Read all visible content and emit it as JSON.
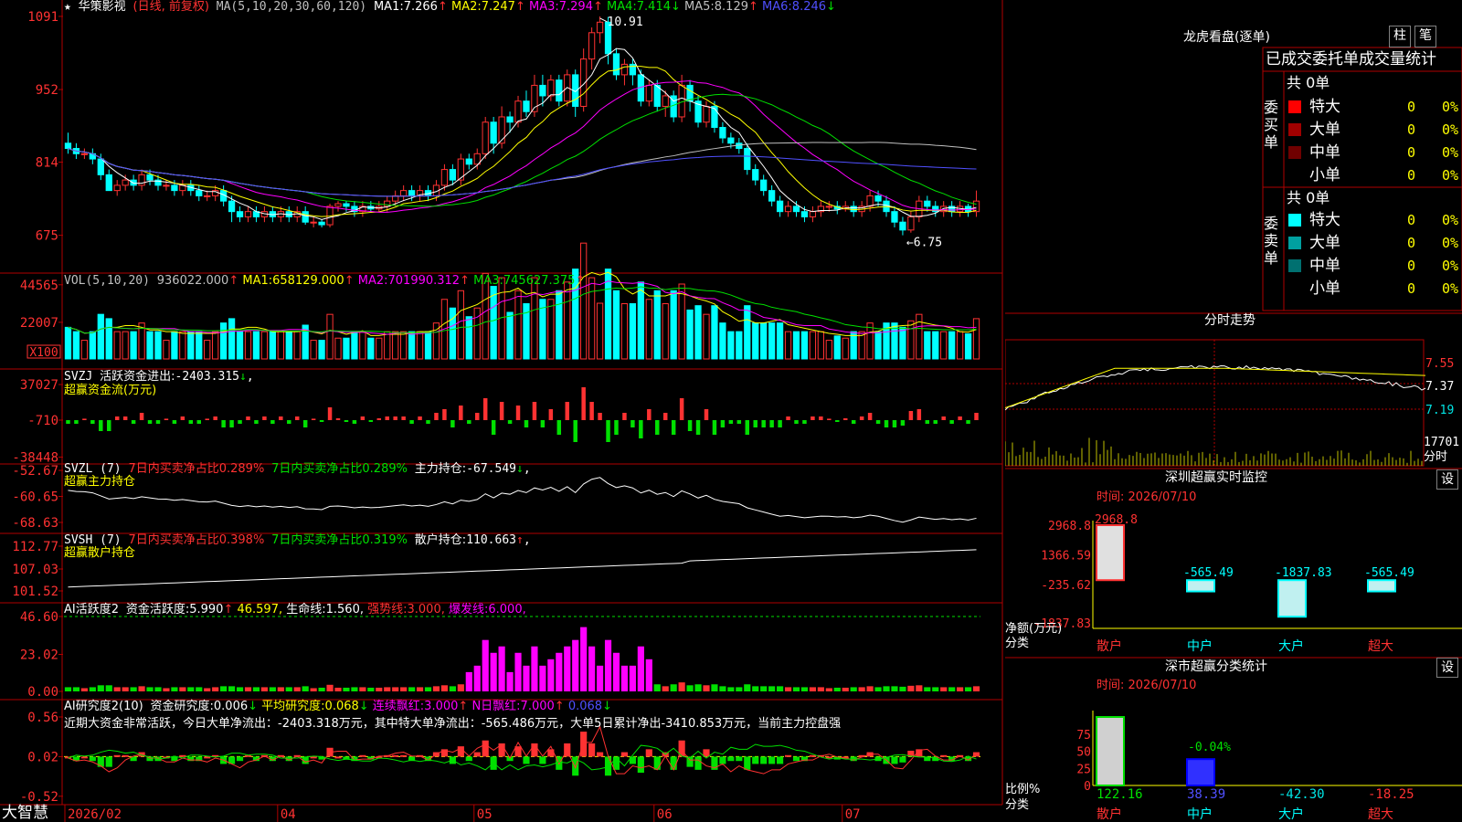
{
  "app": {
    "brand": "大智慧",
    "stock_name": "华策影视",
    "stock_mode": "(日线, 前复权)",
    "star": "★"
  },
  "colors": {
    "up": "#ff3232",
    "down": "#00ffff",
    "ma1": "#ffffff",
    "ma2": "#ffff00",
    "ma3": "#ff00ff",
    "ma4": "#00e000",
    "ma5": "#c0c0c0",
    "ma6": "#5050ff",
    "grid": "#b00000"
  },
  "price_panel": {
    "ma_label": "MA(5,10,20,30,60,120)",
    "ma_values": [
      {
        "label": "MA1:",
        "value": "7.266",
        "arrow": "↑",
        "color": "#ffffff"
      },
      {
        "label": "MA2:",
        "value": "7.247",
        "arrow": "↑",
        "color": "#ffff00"
      },
      {
        "label": "MA3:",
        "value": "7.294",
        "arrow": "↑",
        "color": "#ff00ff"
      },
      {
        "label": "MA4:",
        "value": "7.414",
        "arrow": "↓",
        "color": "#00e000"
      },
      {
        "label": "MA5:",
        "value": "8.129",
        "arrow": "↑",
        "color": "#c0c0c0"
      },
      {
        "label": "MA6:",
        "value": "8.246",
        "arrow": "↓",
        "color": "#5050ff"
      }
    ],
    "yticks": [
      "1091",
      "952",
      "814",
      "675"
    ],
    "high_label": "10.91",
    "low_label": "6.75"
  },
  "vol_panel": {
    "label": "VOL(5,10,20)",
    "items": [
      {
        "label": "",
        "value": "936022.000",
        "arrow": "↑",
        "color": "#c0c0c0"
      },
      {
        "label": "MA1:",
        "value": "658129.000",
        "arrow": "↑",
        "color": "#ffff00"
      },
      {
        "label": "MA2:",
        "value": "701990.312",
        "arrow": "↑",
        "color": "#ff00ff"
      },
      {
        "label": "MA3:",
        "value": "745627.375",
        "arrow": "↑",
        "color": "#00e000"
      }
    ],
    "yticks": [
      "44565",
      "22007"
    ],
    "unit": "X100"
  },
  "svzj_panel": {
    "name": "SVZJ",
    "label": "活跃资金进出:",
    "value": "-2403.315",
    "arrow": "↓",
    "suffix": ",",
    "subtitle": "超赢资金流(万元)",
    "yticks": [
      "37027",
      "-710",
      "-38448"
    ]
  },
  "svzl_panel": {
    "name": "SVZL (7)",
    "text1": "7日内买卖净占比0.289%",
    "text2": "7日内买卖净占比0.289%",
    "label": "主力持仓:",
    "value": "-67.549",
    "arrow": "↓",
    "suffix": ",",
    "subtitle": "超赢主力持仓",
    "yticks": [
      "-52.67",
      "-60.65",
      "-68.63"
    ]
  },
  "svsh_panel": {
    "name": "SVSH (7)",
    "text1": "7日内买卖净占比0.398%",
    "text2": "7日内买卖净占比0.319%",
    "label": "散户持仓:",
    "value": "110.663",
    "arrow": "↑",
    "suffix": ",",
    "subtitle": "超赢散户持仓",
    "yticks": [
      "112.77",
      "107.03",
      "101.52"
    ]
  },
  "ai_active_panel": {
    "name": "AI活跃度2",
    "items": [
      {
        "label": "资金活跃度:",
        "value": "5.990",
        "arrow": "↑",
        "color": "#ffffff"
      },
      {
        "label": "",
        "value": "46.597",
        "arrow": ",",
        "color": "#ffff00"
      },
      {
        "label": "生命线:",
        "value": "1.560",
        "arrow": ",",
        "color": "#ffffff"
      },
      {
        "label": "强势线:",
        "value": "3.000",
        "arrow": ",",
        "color": "#ff3232"
      },
      {
        "label": "爆发线:",
        "value": "6.000",
        "arrow": ",",
        "color": "#ff00ff"
      }
    ],
    "yticks": [
      "46.60",
      "23.02",
      "0.00"
    ]
  },
  "ai_research_panel": {
    "name": "AI研究度2(10)",
    "items": [
      {
        "label": "资金研究度:",
        "value": "0.006",
        "arrow": "↓",
        "color": "#ffffff"
      },
      {
        "label": "平均研究度:",
        "value": "0.068",
        "arrow": "↓",
        "color": "#ffff00"
      },
      {
        "label": "连续飘红:",
        "value": "3.000",
        "arrow": "↑",
        "color": "#ff00ff"
      },
      {
        "label": "N日飘红:",
        "value": "7.000",
        "arrow": "↑",
        "color": "#ff00ff"
      },
      {
        "label": "",
        "value": "0.068",
        "arrow": "↓",
        "color": "#5050ff"
      }
    ],
    "comment": "近期大资金非常活跃，今日大单净流出：-2403.318万元，其中特大单净流出：-565.486万元，大单5日累计净出-3410.853万元，当前主力控盘强",
    "yticks": [
      "0.56",
      "0.02",
      "-0.52"
    ]
  },
  "x_axis": {
    "labels": [
      "2026/02",
      "04",
      "05",
      "06",
      "07"
    ]
  },
  "lhb": {
    "title": "龙虎看盘(逐单)",
    "btn_bar": "柱",
    "btn_pen": "笔",
    "subtitle": "已成交委托单成交量统计",
    "buy_side": "委买单",
    "sell_side": "委卖单",
    "buy_total": "共 0单",
    "sell_total": "共 0单",
    "buy_rows": [
      {
        "name": "特大",
        "count": "0",
        "pct": "0%",
        "color": "#ff0000"
      },
      {
        "name": "大单",
        "count": "0",
        "pct": "0%",
        "color": "#a00000"
      },
      {
        "name": "中单",
        "count": "0",
        "pct": "0%",
        "color": "#700000"
      },
      {
        "name": "小单",
        "count": "0",
        "pct": "0%",
        "color": "#000000"
      }
    ],
    "sell_rows": [
      {
        "name": "特大",
        "count": "0",
        "pct": "0%",
        "color": "#00ffff"
      },
      {
        "name": "大单",
        "count": "0",
        "pct": "0%",
        "color": "#00a0a0"
      },
      {
        "name": "中单",
        "count": "0",
        "pct": "0%",
        "color": "#007070"
      },
      {
        "name": "小单",
        "count": "0",
        "pct": "0%",
        "color": "#000000"
      }
    ]
  },
  "intraday": {
    "title": "分时走势",
    "yticks": [
      "7.55",
      "7.37",
      "7.19"
    ],
    "vol_label": "17701",
    "unit": "分时"
  },
  "sz_monitor": {
    "title": "深圳超赢实时监控",
    "setting_btn": "设",
    "time": "时间: 2026/07/10",
    "yticks": [
      "2968.8",
      "1366.59",
      "-235.62",
      "-1837.83"
    ],
    "ylabel": "净额(万元)",
    "xlabel": "分类",
    "categories": [
      "散户",
      "中户",
      "大户",
      "超大"
    ],
    "values": [
      2968.8,
      -565.49,
      -1837.83,
      -565.49
    ],
    "value_labels": [
      "2968.8",
      "-565.49",
      "-1837.83",
      "-565.49"
    ]
  },
  "sz_class": {
    "title": "深市超赢分类统计",
    "setting_btn": "设",
    "time": "时间: 2026/07/10",
    "yticks": [
      "75",
      "50",
      "25",
      "0"
    ],
    "ylabel": "比例%",
    "xlabel": "分类",
    "categories": [
      "散户",
      "中户",
      "大户",
      "超大"
    ],
    "values": [
      122.16,
      38.39,
      -42.3,
      -18.25
    ],
    "value_labels": [
      "122.16",
      "38.39",
      "-42.30",
      "-18.25"
    ],
    "annotation": "-0.04%"
  },
  "chart_data": [
    {
      "type": "candlestick",
      "title": "华策影视",
      "ylim": [
        6.5,
        11.1
      ],
      "x_labels": [
        "2026/02",
        "04",
        "05",
        "06",
        "07"
      ],
      "candles": [
        [
          8.5,
          8.4,
          8.7,
          8.3
        ],
        [
          8.4,
          8.3,
          8.5,
          8.2
        ],
        [
          8.3,
          8.3,
          8.4,
          8.2
        ],
        [
          8.3,
          8.2,
          8.4,
          8.1
        ],
        [
          8.2,
          7.9,
          8.3,
          7.8
        ],
        [
          7.9,
          7.6,
          8.0,
          7.6
        ],
        [
          7.6,
          7.7,
          7.8,
          7.5
        ],
        [
          7.7,
          7.8,
          7.9,
          7.6
        ],
        [
          7.8,
          7.7,
          7.9,
          7.6
        ],
        [
          7.7,
          7.9,
          8.0,
          7.6
        ],
        [
          7.9,
          7.8,
          8.0,
          7.7
        ],
        [
          7.8,
          7.7,
          7.9,
          7.6
        ],
        [
          7.7,
          7.7,
          7.8,
          7.6
        ],
        [
          7.7,
          7.6,
          7.8,
          7.5
        ],
        [
          7.6,
          7.7,
          7.8,
          7.5
        ],
        [
          7.7,
          7.6,
          7.8,
          7.5
        ],
        [
          7.6,
          7.5,
          7.7,
          7.4
        ],
        [
          7.5,
          7.5,
          7.6,
          7.4
        ],
        [
          7.5,
          7.6,
          7.7,
          7.4
        ],
        [
          7.6,
          7.4,
          7.7,
          7.3
        ],
        [
          7.4,
          7.2,
          7.5,
          7.0
        ],
        [
          7.2,
          7.1,
          7.3,
          7.0
        ],
        [
          7.1,
          7.2,
          7.3,
          7.0
        ],
        [
          7.2,
          7.1,
          7.3,
          7.0
        ],
        [
          7.1,
          7.2,
          7.3,
          7.0
        ],
        [
          7.2,
          7.1,
          7.3,
          7.0
        ],
        [
          7.1,
          7.2,
          7.3,
          7.0
        ],
        [
          7.2,
          7.1,
          7.3,
          7.0
        ],
        [
          7.1,
          7.2,
          7.3,
          7.0
        ],
        [
          7.2,
          7.0,
          7.3,
          6.95
        ],
        [
          7.0,
          7.0,
          7.1,
          6.9
        ],
        [
          7.0,
          6.95,
          7.05,
          6.9
        ],
        [
          6.95,
          7.3,
          7.35,
          6.9
        ],
        [
          7.3,
          7.35,
          7.4,
          7.2
        ],
        [
          7.35,
          7.3,
          7.4,
          7.2
        ],
        [
          7.3,
          7.2,
          7.4,
          7.1
        ],
        [
          7.2,
          7.3,
          7.4,
          7.1
        ],
        [
          7.3,
          7.25,
          7.4,
          7.2
        ],
        [
          7.25,
          7.3,
          7.4,
          7.2
        ],
        [
          7.3,
          7.4,
          7.5,
          7.2
        ],
        [
          7.4,
          7.5,
          7.6,
          7.3
        ],
        [
          7.5,
          7.6,
          7.7,
          7.4
        ],
        [
          7.6,
          7.5,
          7.7,
          7.4
        ],
        [
          7.5,
          7.6,
          7.7,
          7.4
        ],
        [
          7.6,
          7.5,
          7.7,
          7.4
        ],
        [
          7.5,
          7.7,
          7.8,
          7.4
        ],
        [
          7.7,
          8.0,
          8.1,
          7.6
        ],
        [
          8.0,
          7.8,
          8.1,
          7.7
        ],
        [
          7.8,
          8.2,
          8.3,
          7.7
        ],
        [
          8.2,
          8.1,
          8.3,
          8.0
        ],
        [
          8.1,
          8.3,
          8.4,
          8.0
        ],
        [
          8.3,
          8.9,
          9.0,
          8.2
        ],
        [
          8.9,
          8.5,
          9.0,
          8.3
        ],
        [
          8.5,
          9.0,
          9.2,
          8.4
        ],
        [
          9.0,
          8.9,
          9.1,
          8.7
        ],
        [
          8.9,
          9.3,
          9.4,
          8.8
        ],
        [
          9.3,
          9.1,
          9.5,
          9.0
        ],
        [
          9.1,
          9.6,
          9.8,
          9.0
        ],
        [
          9.6,
          9.4,
          9.8,
          9.2
        ],
        [
          9.4,
          9.7,
          9.8,
          9.3
        ],
        [
          9.7,
          9.3,
          9.8,
          9.2
        ],
        [
          9.3,
          9.8,
          9.9,
          9.2
        ],
        [
          9.8,
          9.2,
          9.9,
          9.0
        ],
        [
          9.2,
          10.1,
          10.3,
          9.1
        ],
        [
          10.1,
          10.6,
          10.7,
          9.9
        ],
        [
          10.6,
          10.8,
          10.91,
          10.4
        ],
        [
          10.8,
          10.2,
          10.9,
          10.0
        ],
        [
          10.2,
          9.8,
          10.3,
          9.7
        ],
        [
          9.8,
          10.0,
          10.1,
          9.6
        ],
        [
          10.0,
          9.8,
          10.1,
          9.6
        ],
        [
          9.8,
          9.3,
          9.9,
          9.2
        ],
        [
          9.3,
          9.6,
          9.7,
          9.2
        ],
        [
          9.6,
          9.2,
          9.7,
          9.1
        ],
        [
          9.2,
          9.4,
          9.5,
          9.0
        ],
        [
          9.4,
          9.0,
          9.5,
          8.9
        ],
        [
          9.0,
          9.6,
          9.8,
          8.9
        ],
        [
          9.6,
          9.3,
          9.7,
          9.1
        ],
        [
          9.3,
          8.9,
          9.4,
          8.8
        ],
        [
          8.9,
          9.2,
          9.3,
          8.8
        ],
        [
          9.2,
          8.8,
          9.3,
          8.7
        ],
        [
          8.8,
          8.6,
          8.9,
          8.5
        ],
        [
          8.6,
          8.5,
          8.7,
          8.4
        ],
        [
          8.5,
          8.4,
          8.6,
          8.3
        ],
        [
          8.4,
          8.0,
          8.5,
          7.9
        ],
        [
          8.0,
          7.8,
          8.1,
          7.7
        ],
        [
          7.8,
          7.6,
          7.9,
          7.5
        ],
        [
          7.6,
          7.4,
          7.7,
          7.3
        ],
        [
          7.4,
          7.2,
          7.5,
          7.1
        ],
        [
          7.2,
          7.3,
          7.4,
          7.1
        ],
        [
          7.3,
          7.2,
          7.4,
          7.1
        ],
        [
          7.2,
          7.1,
          7.3,
          7.0
        ],
        [
          7.1,
          7.2,
          7.3,
          7.0
        ],
        [
          7.2,
          7.3,
          7.4,
          7.1
        ],
        [
          7.3,
          7.3,
          7.4,
          7.2
        ],
        [
          7.3,
          7.25,
          7.4,
          7.15
        ],
        [
          7.25,
          7.3,
          7.4,
          7.2
        ],
        [
          7.3,
          7.2,
          7.4,
          7.1
        ],
        [
          7.2,
          7.3,
          7.4,
          7.1
        ],
        [
          7.3,
          7.5,
          7.6,
          7.2
        ],
        [
          7.5,
          7.4,
          7.6,
          7.3
        ],
        [
          7.4,
          7.2,
          7.5,
          7.1
        ],
        [
          7.2,
          7.0,
          7.3,
          6.9
        ],
        [
          7.0,
          6.85,
          7.1,
          6.75
        ],
        [
          6.85,
          7.1,
          7.2,
          6.8
        ],
        [
          7.1,
          7.4,
          7.5,
          7.0
        ],
        [
          7.4,
          7.3,
          7.5,
          7.2
        ],
        [
          7.3,
          7.2,
          7.4,
          7.1
        ],
        [
          7.2,
          7.3,
          7.4,
          7.1
        ],
        [
          7.3,
          7.2,
          7.4,
          7.1
        ],
        [
          7.2,
          7.3,
          7.4,
          7.1
        ],
        [
          7.3,
          7.2,
          7.35,
          7.1
        ],
        [
          7.2,
          7.4,
          7.6,
          7.1
        ]
      ]
    }
  ]
}
